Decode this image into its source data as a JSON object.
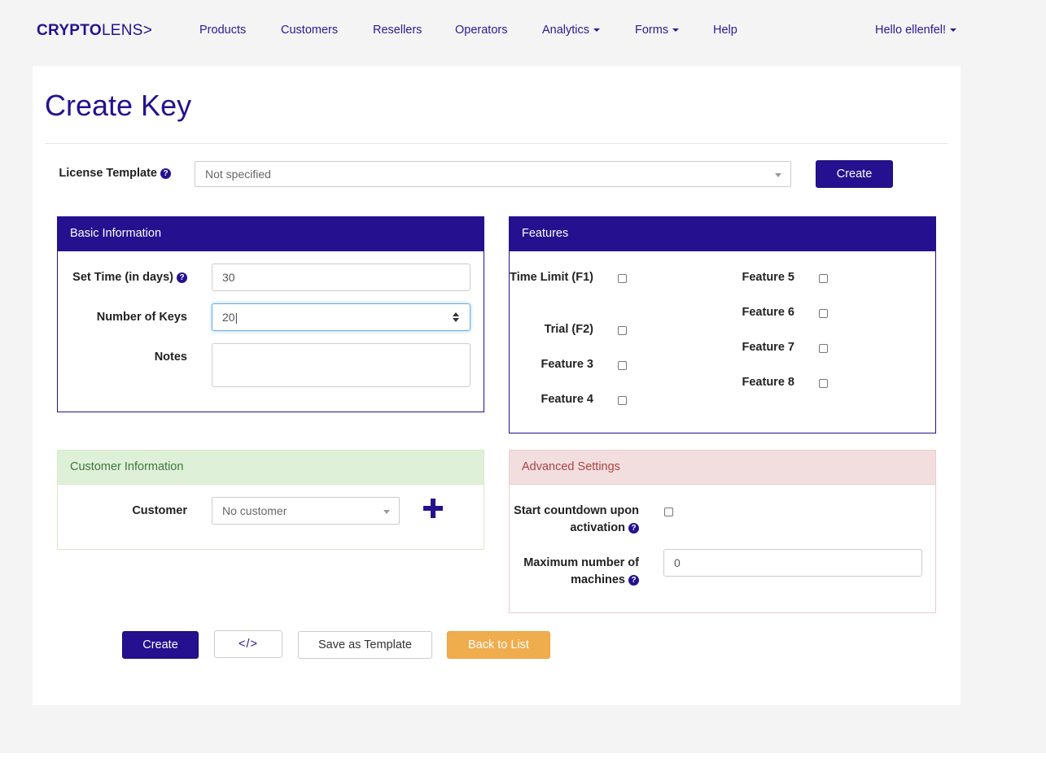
{
  "brand": {
    "bold": "CRYPTO",
    "light": "LENS>"
  },
  "nav": {
    "products": "Products",
    "customers": "Customers",
    "resellers": "Resellers",
    "operators": "Operators",
    "analytics": "Analytics",
    "forms": "Forms",
    "help": "Help",
    "user": "Hello ellenfel!"
  },
  "page": {
    "title": "Create Key"
  },
  "license_template": {
    "label": "License Template",
    "selected": "Not specified",
    "create_label": "Create"
  },
  "basic": {
    "heading": "Basic Information",
    "time_label": "Set Time (in days)",
    "time_value": "30",
    "keys_label": "Number of Keys",
    "keys_value": "20",
    "notes_label": "Notes",
    "notes_value": ""
  },
  "features": {
    "heading": "Features",
    "items": [
      {
        "label": "Time Limit (F1)",
        "checked": false
      },
      {
        "label": "Trial (F2)",
        "checked": false
      },
      {
        "label": "Feature 3",
        "checked": false
      },
      {
        "label": "Feature 4",
        "checked": false
      },
      {
        "label": "Feature 5",
        "checked": false
      },
      {
        "label": "Feature 6",
        "checked": false
      },
      {
        "label": "Feature 7",
        "checked": false
      },
      {
        "label": "Feature 8",
        "checked": false
      }
    ]
  },
  "customer": {
    "heading": "Customer Information",
    "label": "Customer",
    "selected": "No customer"
  },
  "advanced": {
    "heading": "Advanced Settings",
    "countdown_label": "Start countdown upon activation",
    "countdown_checked": false,
    "machines_label": "Maximum number of machines",
    "machines_value": "0"
  },
  "actions": {
    "create": "Create",
    "code": "</>",
    "save_template": "Save as Template",
    "back": "Back to List"
  },
  "colors": {
    "brand": "#25118f",
    "success_bg": "#dff0d8",
    "danger_bg": "#f2dede",
    "warning": "#f0ad4e"
  }
}
